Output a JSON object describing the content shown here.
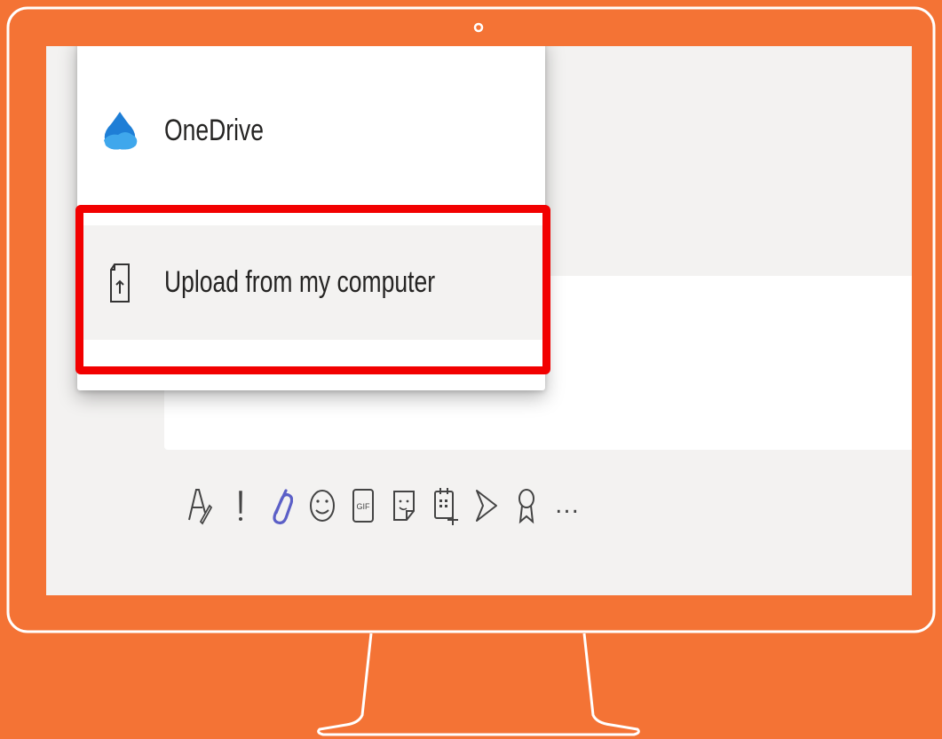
{
  "attach_menu": {
    "items": [
      {
        "label": "OneDrive",
        "icon": "onedrive-icon"
      },
      {
        "label": "Upload from my computer",
        "icon": "upload-file-icon"
      }
    ],
    "highlighted_item": "Upload from my computer"
  },
  "toolbar": {
    "tools": [
      {
        "icon": "format-icon"
      },
      {
        "icon": "important-icon"
      },
      {
        "icon": "attach-icon",
        "active_color": "#5B5FC7"
      },
      {
        "icon": "emoji-icon"
      },
      {
        "icon": "gif-icon"
      },
      {
        "icon": "sticker-icon"
      },
      {
        "icon": "schedule-meeting-icon"
      },
      {
        "icon": "stream-icon"
      },
      {
        "icon": "praise-icon"
      },
      {
        "icon": "more-options-icon",
        "label": "..."
      }
    ]
  },
  "colors": {
    "frame": "#F47335",
    "highlight": "#F20000",
    "screen_background": "#F3F2F1",
    "onedrive_blue": "#1E7ED6"
  }
}
